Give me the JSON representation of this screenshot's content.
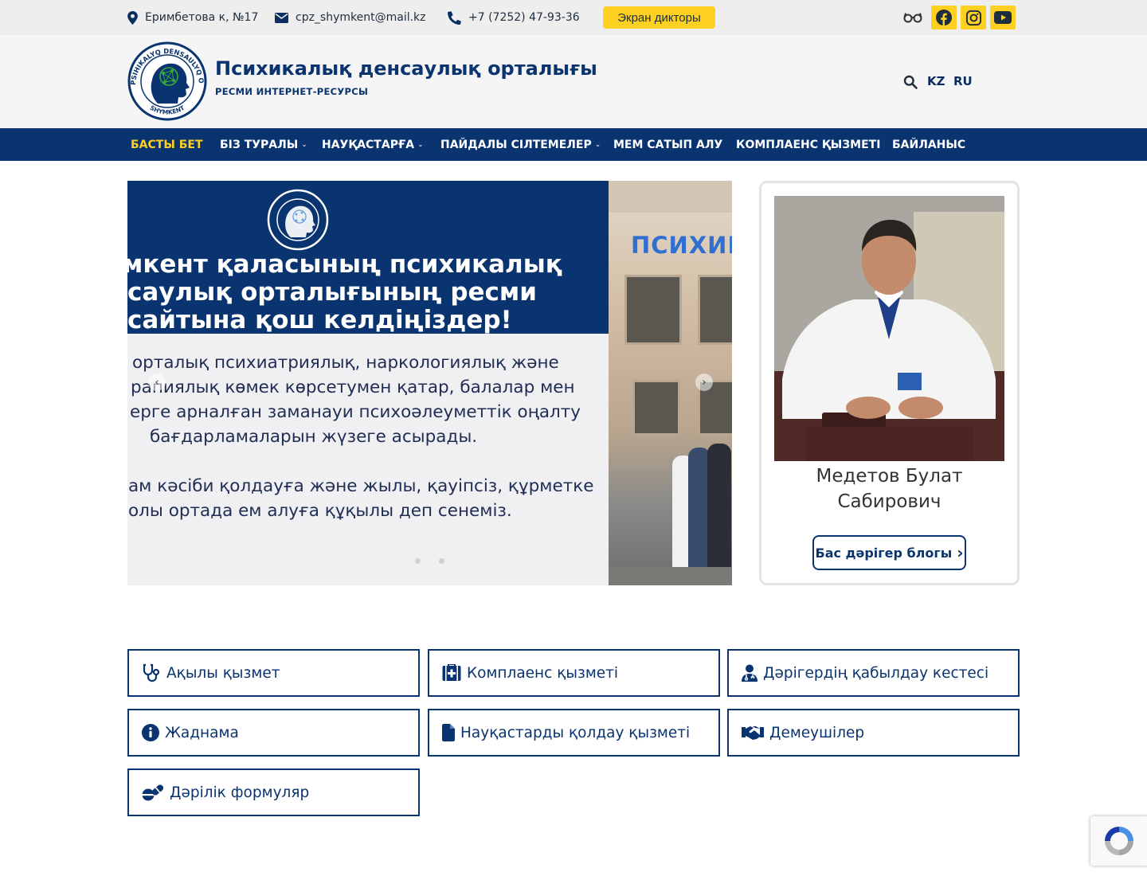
{
  "topbar": {
    "address": "Еримбетова к, №17",
    "email": "cpz_shymkent@mail.kz",
    "phone": "+7 (7252) 47-93-36",
    "screen_reader": "Экран дикторы",
    "icons": [
      "map-marker-icon",
      "envelope-icon",
      "phone-icon",
      "glasses-icon",
      "facebook-icon",
      "instagram-icon",
      "youtube-icon"
    ],
    "accent": "#fdd021"
  },
  "header": {
    "title": "Психикалық денсаулық орталығы",
    "subtitle": "РЕСМИ ИНТЕРНЕТ-РЕСУРСЫ",
    "logo_text_top": "PSIHIKALYQ DENSAULYQ ORTALYGY",
    "logo_text_bottom": "SHYMKENT",
    "languages": [
      "KZ",
      "RU"
    ]
  },
  "nav": {
    "items": [
      {
        "label": "БАСТЫ БЕТ",
        "active": true
      },
      {
        "label": "БІЗ ТУРАЛЫ",
        "dropdown": true
      },
      {
        "label": "НАУҚАСТАРҒА",
        "dropdown": true
      },
      {
        "label": "ПАЙДАЛЫ СІЛТЕМЕЛЕР",
        "dropdown": true
      },
      {
        "label": "МЕМ САТЫП АЛУ"
      },
      {
        "label": "КОМПЛАЕНС ҚЫЗМЕТІ"
      },
      {
        "label": "БАЙЛАНЫС"
      }
    ],
    "chevron": "⌄",
    "color": "#0a3470"
  },
  "slider": {
    "headline": [
      "мкент қаласының психикалық",
      "саулық орталығының ресми",
      "сайтына қош келдіңіздер!"
    ],
    "body": [
      "орталық психиатриялық, наркологиялық және",
      "рапиялық көмек көрсетумен қатар, балалар мен",
      "ерге арналған заманауи психоәлеуметтік оңалту",
      "бағдарламаларын жүзеге асырады.",
      "",
      "ам кәсіби қолдауға және жылы, қауіпсіз, құрметке",
      "олы ортада ем алуға құқылы деп сенеміз."
    ],
    "photo_sign": "ПСИХИК",
    "prev": "‹",
    "next": "›"
  },
  "doctor": {
    "name": "Медетов Булат Сабирович",
    "blog_button": "Бас дәрігер блогы",
    "blog_chevron": "›"
  },
  "quick_links": [
    {
      "label": "Ақылы қызмет",
      "icon": "stethoscope-icon"
    },
    {
      "label": "Комплаенс қызметі",
      "icon": "medkit-icon"
    },
    {
      "label": "Дәрігердің қабылдау кестесі",
      "icon": "user-doctor-icon"
    },
    {
      "label": "Жаднама",
      "icon": "info-circle-icon"
    },
    {
      "label": "Науқастарды қолдау қызметі",
      "icon": "file-icon"
    },
    {
      "label": "Демеушілер",
      "icon": "handshake-icon"
    },
    {
      "label": "Дәрілік формуляр",
      "icon": "pills-icon"
    }
  ]
}
